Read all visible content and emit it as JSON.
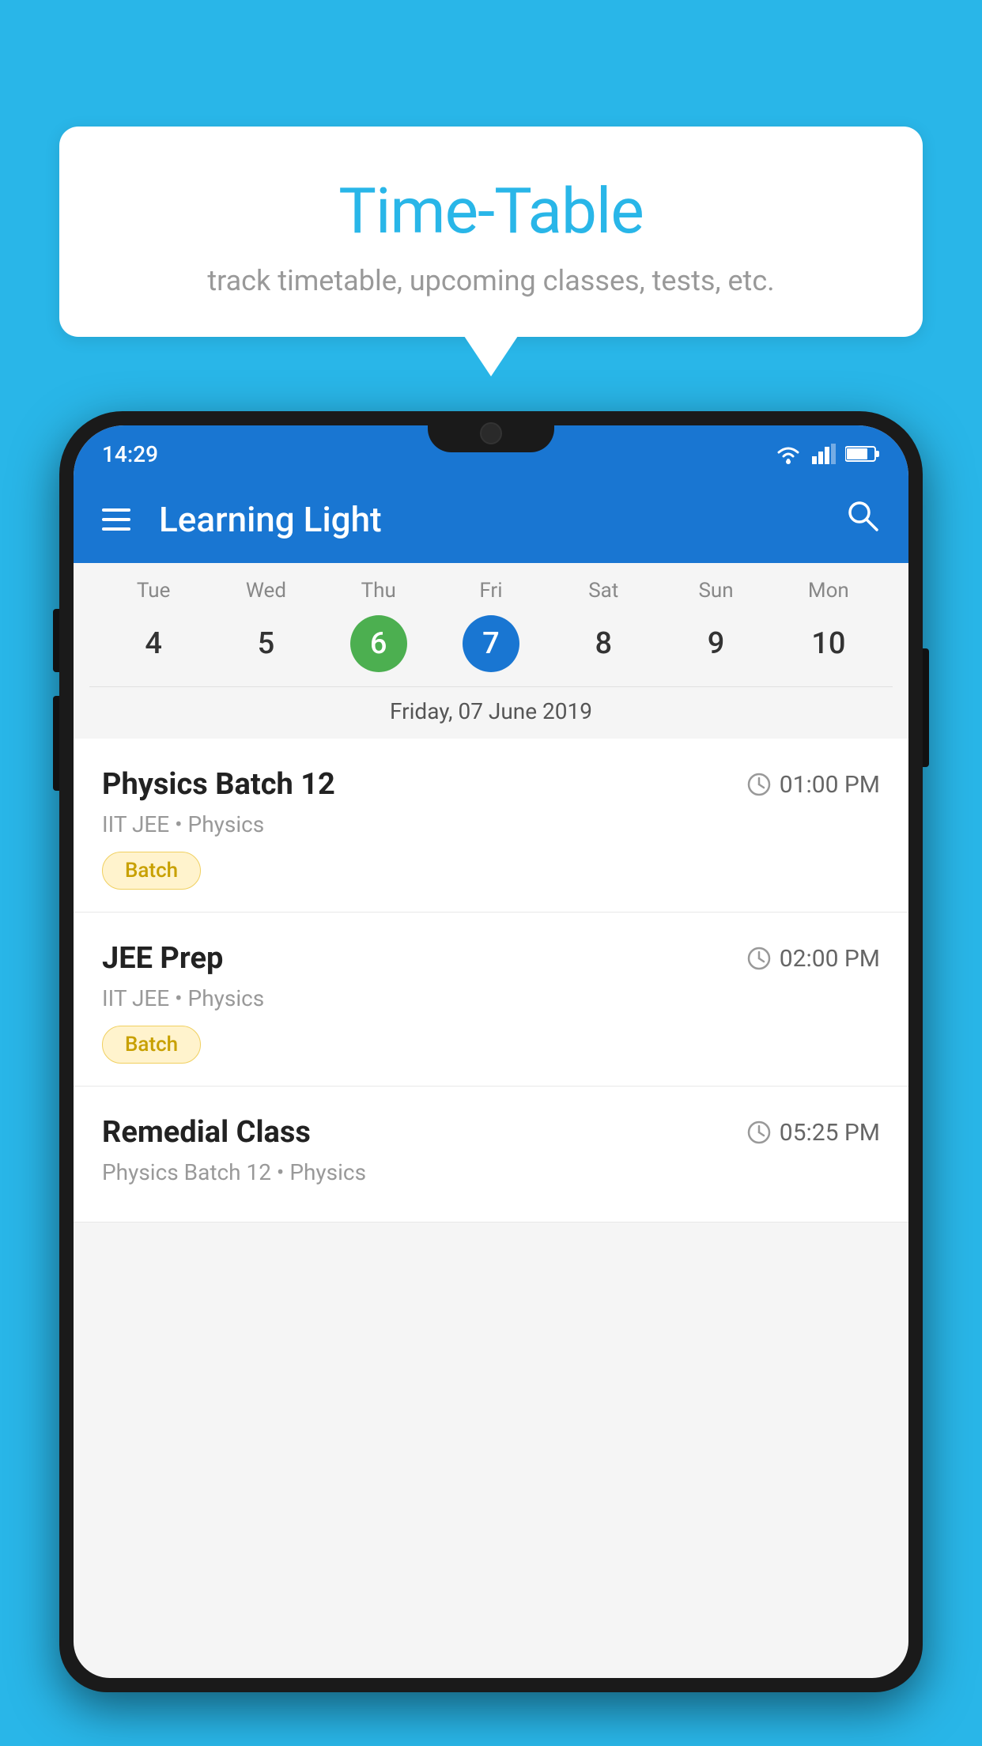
{
  "background_color": "#29b6e8",
  "bubble": {
    "title": "Time-Table",
    "subtitle": "track timetable, upcoming classes, tests, etc."
  },
  "phone": {
    "status_bar": {
      "time": "14:29"
    },
    "app_bar": {
      "title": "Learning Light"
    },
    "calendar": {
      "weekdays": [
        {
          "label": "Tue",
          "number": "4"
        },
        {
          "label": "Wed",
          "number": "5"
        },
        {
          "label": "Thu",
          "number": "6",
          "state": "today"
        },
        {
          "label": "Fri",
          "number": "7",
          "state": "selected"
        },
        {
          "label": "Sat",
          "number": "8"
        },
        {
          "label": "Sun",
          "number": "9"
        },
        {
          "label": "Mon",
          "number": "10"
        }
      ],
      "selected_date": "Friday, 07 June 2019"
    },
    "schedule": [
      {
        "title": "Physics Batch 12",
        "time": "01:00 PM",
        "meta": "IIT JEE • Physics",
        "tag": "Batch"
      },
      {
        "title": "JEE Prep",
        "time": "02:00 PM",
        "meta": "IIT JEE • Physics",
        "tag": "Batch"
      },
      {
        "title": "Remedial Class",
        "time": "05:25 PM",
        "meta": "Physics Batch 12 • Physics",
        "tag": ""
      }
    ]
  }
}
